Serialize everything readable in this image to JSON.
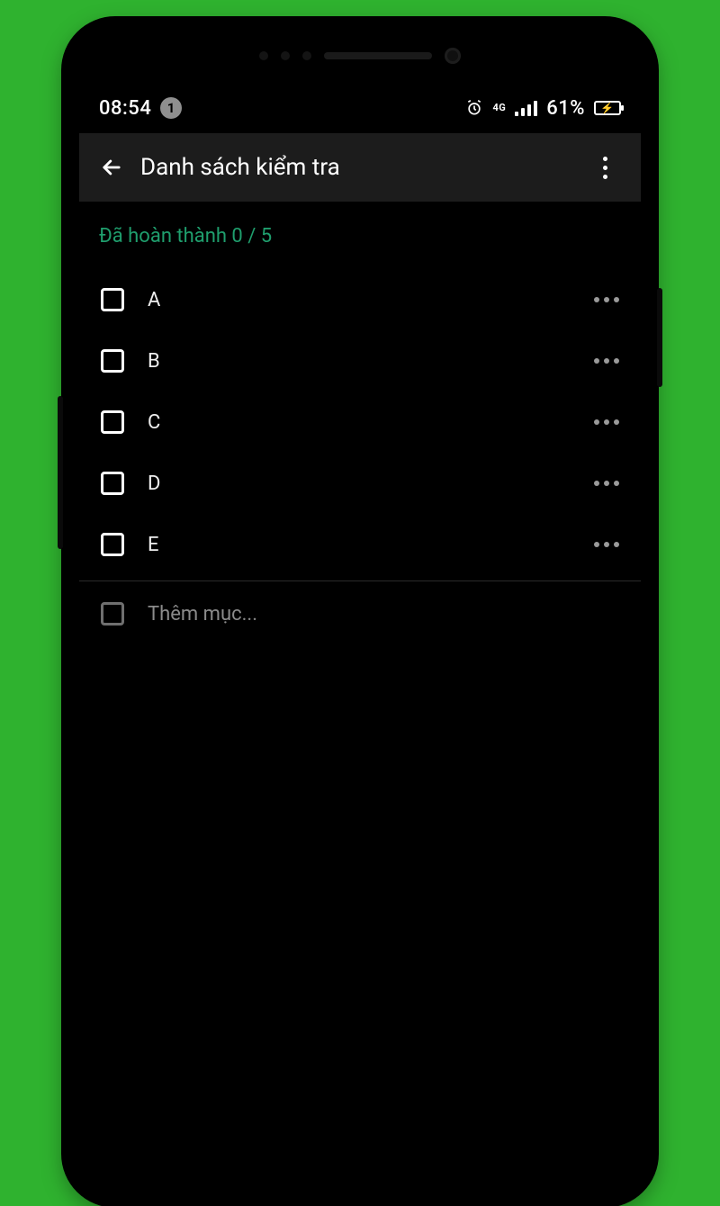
{
  "statusbar": {
    "time": "08:54",
    "notif_count": "1",
    "network": "4G",
    "battery_text": "61%"
  },
  "appbar": {
    "title": "Danh sách kiểm tra"
  },
  "progress_text": "Đã hoàn thành 0 / 5",
  "items": [
    {
      "label": "A"
    },
    {
      "label": "B"
    },
    {
      "label": "C"
    },
    {
      "label": "D"
    },
    {
      "label": "E"
    }
  ],
  "add_placeholder": "Thêm mục..."
}
